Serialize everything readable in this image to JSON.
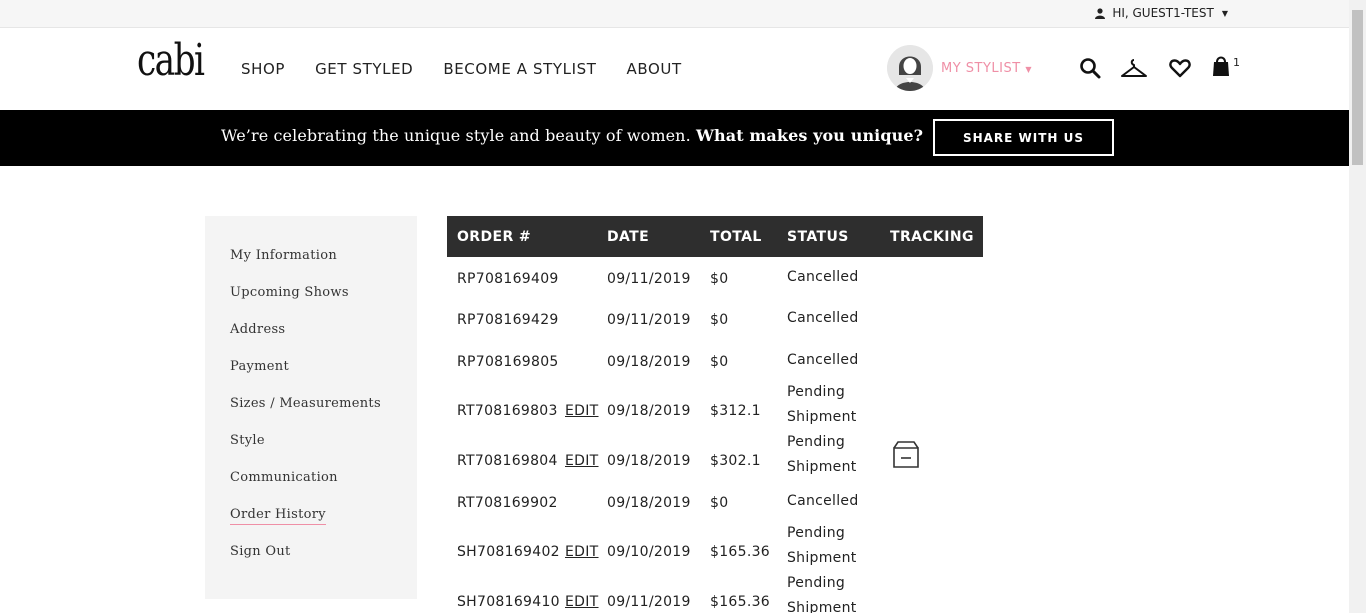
{
  "topbar": {
    "greeting": "HI, GUEST1-TEST"
  },
  "header": {
    "logo": "cabi",
    "nav": [
      "SHOP",
      "GET STYLED",
      "BECOME A STYLIST",
      "ABOUT"
    ],
    "stylist_label": "MY STYLIST",
    "cart_count": "1"
  },
  "promo": {
    "text": "We’re celebrating the unique style and beauty of women.",
    "highlight": "What makes you unique?",
    "button": "SHARE WITH US"
  },
  "sidebar": {
    "items": [
      "My Information",
      "Upcoming Shows",
      "Address",
      "Payment",
      "Sizes / Measurements",
      "Style",
      "Communication",
      "Order History",
      "Sign Out"
    ],
    "active_index": 7
  },
  "orders": {
    "headers": [
      "ORDER #",
      "DATE",
      "TOTAL",
      "STATUS",
      "TRACKING"
    ],
    "edit_label": "EDIT",
    "rows": [
      {
        "order": "RP708169409",
        "editable": false,
        "date": "09/11/2019",
        "total": "$0",
        "status": "Cancelled",
        "tracking": false
      },
      {
        "order": "RP708169429",
        "editable": false,
        "date": "09/11/2019",
        "total": "$0",
        "status": "Cancelled",
        "tracking": false
      },
      {
        "order": "RP708169805",
        "editable": false,
        "date": "09/18/2019",
        "total": "$0",
        "status": "Cancelled",
        "tracking": false
      },
      {
        "order": "RT708169803",
        "editable": true,
        "date": "09/18/2019",
        "total": "$312.1",
        "status": "Pending Shipment",
        "tracking": false
      },
      {
        "order": "RT708169804",
        "editable": true,
        "date": "09/18/2019",
        "total": "$302.1",
        "status": "Pending Shipment",
        "tracking": true
      },
      {
        "order": "RT708169902",
        "editable": false,
        "date": "09/18/2019",
        "total": "$0",
        "status": "Cancelled",
        "tracking": false
      },
      {
        "order": "SH708169402",
        "editable": true,
        "date": "09/10/2019",
        "total": "$165.36",
        "status": "Pending Shipment",
        "tracking": false
      },
      {
        "order": "SH708169410",
        "editable": true,
        "date": "09/11/2019",
        "total": "$165.36",
        "status": "Pending Shipment",
        "tracking": false
      }
    ]
  },
  "colors": {
    "accent_pink": "#ef8fa6",
    "promo_bg": "#000000",
    "table_header": "#2e2e2e"
  },
  "icons": [
    "user-icon",
    "search-icon",
    "hanger-icon",
    "heart-icon",
    "shopping-bag-icon",
    "package-icon"
  ]
}
